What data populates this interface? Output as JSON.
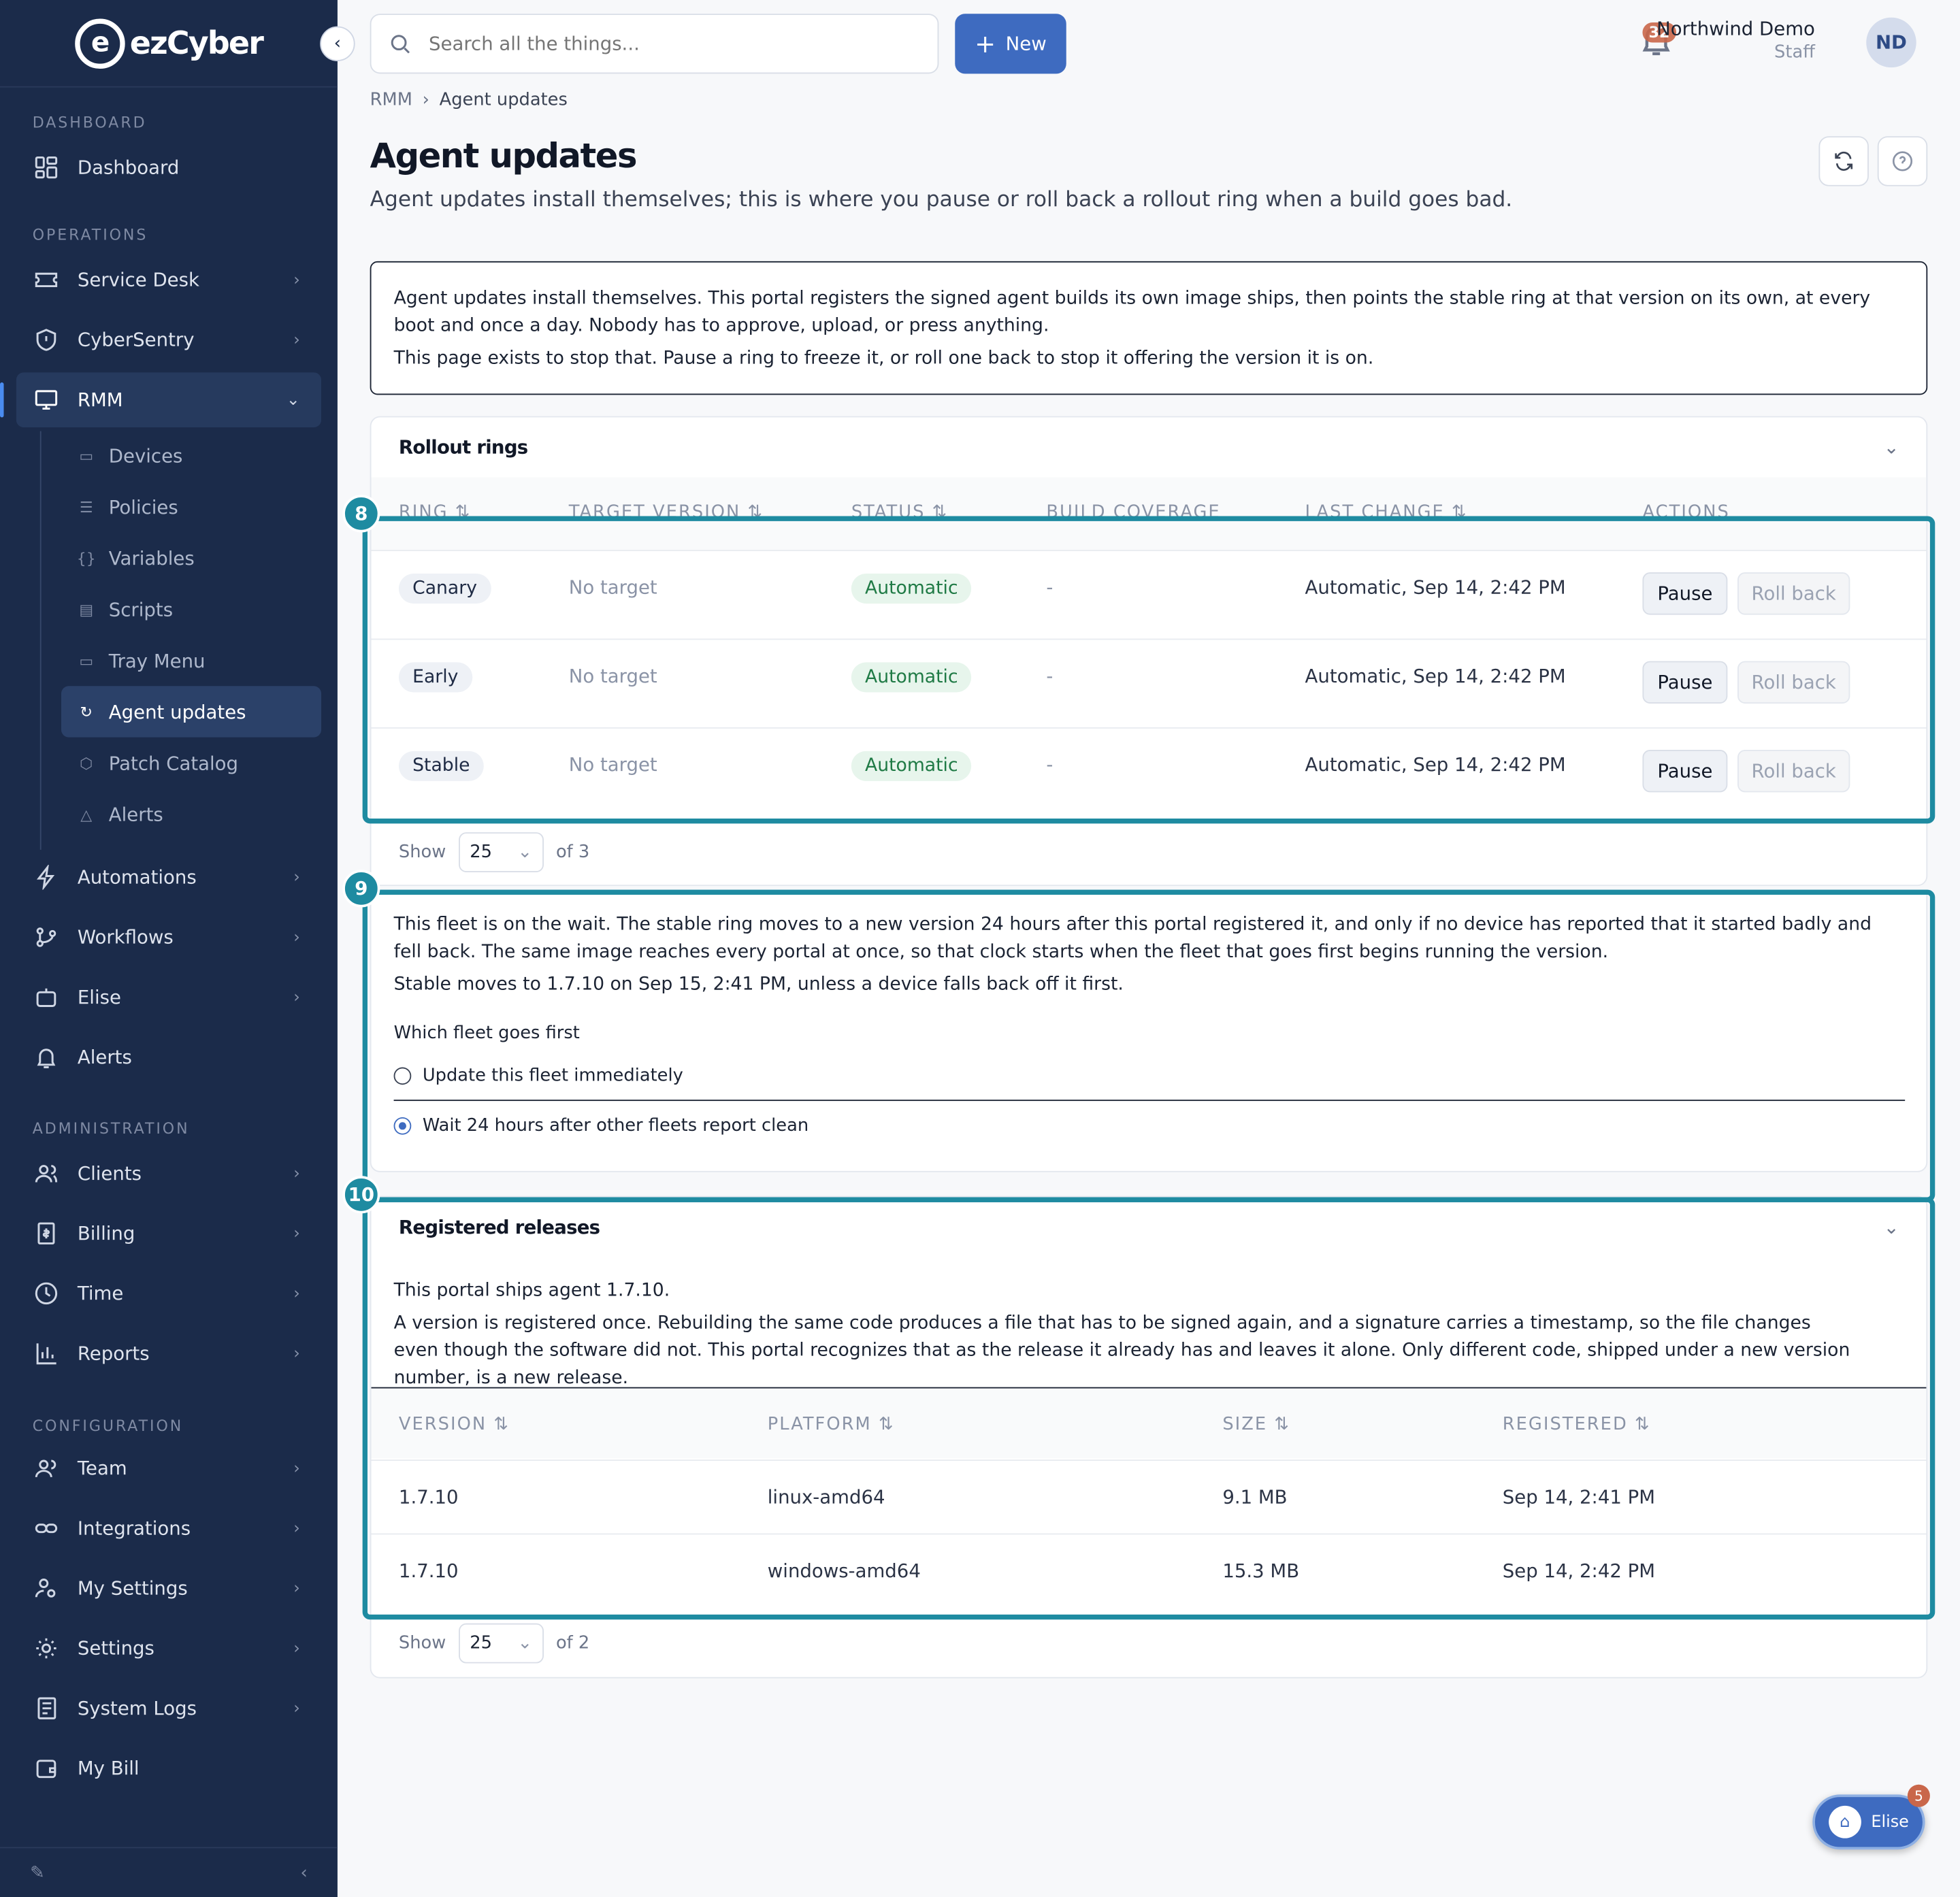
{
  "app": {
    "brand": "ezCyber"
  },
  "sidebar": {
    "sections": {
      "dashboard": "DASHBOARD",
      "operations": "OPERATIONS",
      "administration": "ADMINISTRATION",
      "configuration": "CONFIGURATION"
    },
    "items": {
      "dashboard": "Dashboard",
      "service_desk": "Service Desk",
      "cybersentry": "CyberSentry",
      "rmm": "RMM",
      "automations": "Automations",
      "workflows": "Workflows",
      "elise": "Elise",
      "alerts": "Alerts",
      "clients": "Clients",
      "billing": "Billing",
      "time": "Time",
      "reports": "Reports",
      "team": "Team",
      "integrations": "Integrations",
      "my_settings": "My Settings",
      "settings": "Settings",
      "system_logs": "System Logs",
      "my_bill": "My Bill"
    },
    "rmm_sub": {
      "devices": "Devices",
      "policies": "Policies",
      "variables": "Variables",
      "scripts": "Scripts",
      "tray_menu": "Tray Menu",
      "agent_updates": "Agent updates",
      "patch_catalog": "Patch Catalog",
      "alerts": "Alerts"
    }
  },
  "topbar": {
    "search_placeholder": "Search all the things...",
    "new_label": "New",
    "notification_count": "32",
    "user_name": "Northwind Demo",
    "user_role": "Staff",
    "avatar_initials": "ND"
  },
  "breadcrumb": {
    "parent": "RMM",
    "current": "Agent updates"
  },
  "page": {
    "title": "Agent updates",
    "subtitle": "Agent updates install themselves; this is where you pause or roll back a rollout ring when a build goes bad."
  },
  "info_box": {
    "line1": "Agent updates install themselves. This portal registers the signed agent builds its own image ships, then points the stable ring at that version on its own, at every boot and once a day. Nobody has to approve, upload, or press anything.",
    "line2": "This page exists to stop that. Pause a ring to freeze it, or roll one back to stop it offering the version it is on."
  },
  "rollout": {
    "title": "Rollout rings",
    "columns": {
      "ring": "RING",
      "target_version": "TARGET VERSION",
      "status": "STATUS",
      "build_coverage": "BUILD COVERAGE",
      "last_change": "LAST CHANGE",
      "actions": "ACTIONS"
    },
    "rows": [
      {
        "ring": "Canary",
        "target": "No target",
        "status": "Automatic",
        "coverage": "-",
        "last_change": "Automatic, Sep 14, 2:42 PM",
        "pause": "Pause",
        "rollback": "Roll back"
      },
      {
        "ring": "Early",
        "target": "No target",
        "status": "Automatic",
        "coverage": "-",
        "last_change": "Automatic, Sep 14, 2:42 PM",
        "pause": "Pause",
        "rollback": "Roll back"
      },
      {
        "ring": "Stable",
        "target": "No target",
        "status": "Automatic",
        "coverage": "-",
        "last_change": "Automatic, Sep 14, 2:42 PM",
        "pause": "Pause",
        "rollback": "Roll back"
      }
    ],
    "show_label": "Show",
    "page_size": "25",
    "of_total": "of 3"
  },
  "fleet": {
    "line1": "This fleet is on the wait. The stable ring moves to a new version 24 hours after this portal registered it, and only if no device has reported that it started badly and fell back. The same image reaches every portal at once, so that clock starts when the fleet that goes first begins running the version.",
    "line2": "Stable moves to 1.7.10 on Sep 15, 2:41 PM, unless a device falls back off it first.",
    "question": "Which fleet goes first",
    "option_immediate": "Update this fleet immediately",
    "option_wait": "Wait 24 hours after other fleets report clean"
  },
  "releases": {
    "title": "Registered releases",
    "ships_line": "This portal ships agent 1.7.10.",
    "explain": "A version is registered once. Rebuilding the same code produces a file that has to be signed again, and a signature carries a timestamp, so the file changes even though the software did not. This portal recognizes that as the release it already has and leaves it alone. Only different code, shipped under a new version number, is a new release.",
    "columns": {
      "version": "VERSION",
      "platform": "PLATFORM",
      "size": "SIZE",
      "registered": "REGISTERED"
    },
    "rows": [
      {
        "version": "1.7.10",
        "platform": "linux-amd64",
        "size": "9.1 MB",
        "registered": "Sep 14, 2:41 PM"
      },
      {
        "version": "1.7.10",
        "platform": "windows-amd64",
        "size": "15.3 MB",
        "registered": "Sep 14, 2:42 PM"
      }
    ],
    "show_label": "Show",
    "page_size": "25",
    "of_total": "of 2"
  },
  "markers": {
    "m8": "8",
    "m9": "9",
    "m10": "10"
  },
  "assistant": {
    "label": "Elise",
    "badge": "5"
  },
  "colors": {
    "sidebar_bg": "#1b2b4a",
    "accent": "#3e6bc0",
    "highlight": "#1e8ba1",
    "status_green": "#1f7a45"
  }
}
